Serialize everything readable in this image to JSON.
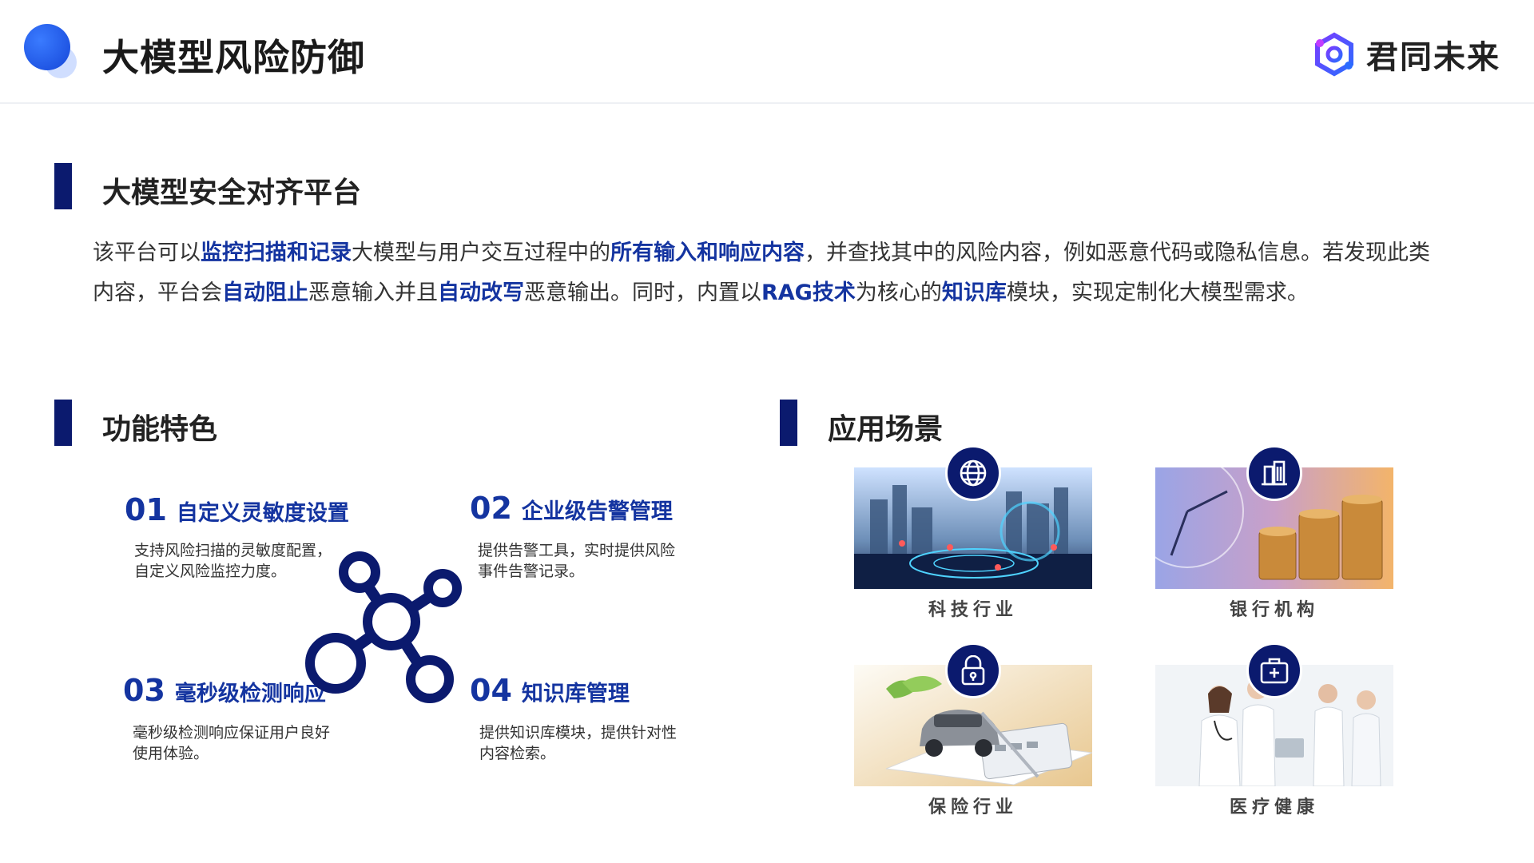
{
  "header": {
    "title": "大模型风险防御",
    "brand_name": "君同未来",
    "colors": {
      "accent": "#1546d8",
      "navy": "#0b1a6e",
      "highlight": "#1434a0"
    }
  },
  "platform": {
    "heading": "大模型安全对齐平台",
    "intro": [
      {
        "t": "该平台可以",
        "hl": false
      },
      {
        "t": "监控扫描和记录",
        "hl": true
      },
      {
        "t": "大模型与用户交互过程中的",
        "hl": false
      },
      {
        "t": "所有输入和响应内容",
        "hl": true
      },
      {
        "t": "，并查找其中的风险内容，例如恶意代码或隐私信息。若发现此类内容，平台会",
        "hl": false
      },
      {
        "t": "自动阻止",
        "hl": true
      },
      {
        "t": "恶意输入并且",
        "hl": false
      },
      {
        "t": "自动改写",
        "hl": true
      },
      {
        "t": "恶意输出。同时，内置以",
        "hl": false
      },
      {
        "t": "RAG技术",
        "hl": true
      },
      {
        "t": "为核心的",
        "hl": false
      },
      {
        "t": "知识库",
        "hl": true
      },
      {
        "t": "模块，实现定制化大模型需求。",
        "hl": false
      }
    ]
  },
  "features": {
    "heading": "功能特色",
    "items": [
      {
        "num": "01",
        "name": "自定义灵敏度设置",
        "desc": "支持风险扫描的灵敏度配置，自定义风险监控力度。"
      },
      {
        "num": "02",
        "name": "企业级告警管理",
        "desc": "提供告警工具，实时提供风险事件告警记录。"
      },
      {
        "num": "03",
        "name": "毫秒级检测响应",
        "desc": "毫秒级检测响应保证用户良好使用体验。"
      },
      {
        "num": "04",
        "name": "知识库管理",
        "desc": "提供知识库模块，提供针对性内容检索。"
      }
    ],
    "center_icon": "molecule-network-icon"
  },
  "scenarios": {
    "heading": "应用场景",
    "items": [
      {
        "label": "科技行业",
        "icon": "globe-icon"
      },
      {
        "label": "银行机构",
        "icon": "building-icon"
      },
      {
        "label": "保险行业",
        "icon": "lock-icon"
      },
      {
        "label": "医疗健康",
        "icon": "medical-kit-icon"
      }
    ]
  }
}
